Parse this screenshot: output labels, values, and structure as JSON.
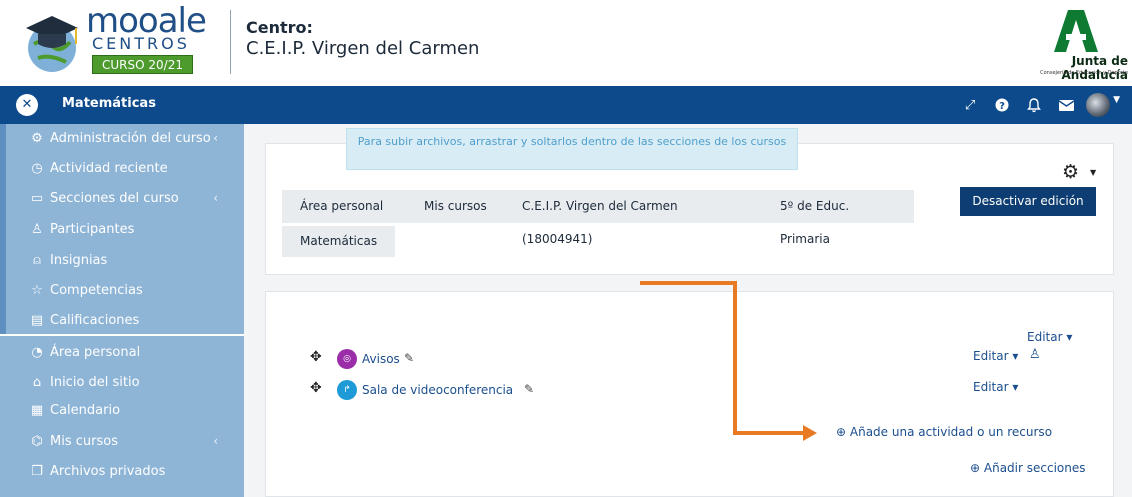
{
  "header": {
    "logo": {
      "word": "mooale",
      "sub": "CENTROS",
      "year": "CURSO 20/21"
    },
    "centro_label": "Centro:",
    "centro_name": "C.E.I.P. Virgen del Carmen",
    "junta": {
      "name": "Junta de Andalucía",
      "sub": "Consejería de Educación y Deporte"
    }
  },
  "navbar": {
    "course_title": "Matemáticas",
    "icons": [
      "expand-icon",
      "help-icon",
      "bell-icon",
      "mail-icon",
      "avatar"
    ]
  },
  "sidebar": {
    "items": [
      {
        "label": "Administración del curso",
        "icon": "gears-icon",
        "has_chevron": true
      },
      {
        "label": "Actividad reciente",
        "icon": "clock-icon",
        "has_chevron": false
      },
      {
        "label": "Secciones del curso",
        "icon": "folder-icon",
        "has_chevron": true
      },
      {
        "label": "Participantes",
        "icon": "users-icon",
        "has_chevron": false
      },
      {
        "label": "Insignias",
        "icon": "badge-icon",
        "has_chevron": false
      },
      {
        "label": "Competencias",
        "icon": "star-icon",
        "has_chevron": false
      },
      {
        "label": "Calificaciones",
        "icon": "grades-icon",
        "has_chevron": false
      },
      {
        "label": "Área personal",
        "icon": "dashboard-icon",
        "has_chevron": false
      },
      {
        "label": "Inicio del sitio",
        "icon": "home-icon",
        "has_chevron": false
      },
      {
        "label": "Calendario",
        "icon": "calendar-icon",
        "has_chevron": false
      },
      {
        "label": "Mis cursos",
        "icon": "graduation-cap-icon",
        "has_chevron": true
      },
      {
        "label": "Archivos privados",
        "icon": "files-icon",
        "has_chevron": false
      }
    ]
  },
  "main": {
    "tooltip": "Para subir archivos, arrastrar y soltarlos dentro de las secciones de los cursos",
    "breadcrumbs": [
      "Área personal",
      "Mis cursos",
      "C.E.I.P. Virgen del Carmen (18004941)",
      "5º de Educ. Primaria",
      "Matemáticas"
    ],
    "desactivar_label": "Desactivar edición",
    "section_edit_label": "Editar ▾",
    "modules": [
      {
        "name": "Avisos",
        "badge_color": "#9b2ea8",
        "edit_label": "Editar ▾",
        "has_person": true
      },
      {
        "name": "Sala de videoconferencia",
        "badge_color": "#1e9ad6",
        "edit_label": "Editar ▾",
        "has_person": false
      }
    ],
    "add_activity": "Añade una actividad o un recurso",
    "add_sections": "Añadir secciones",
    "accent_color": "#e87a24"
  }
}
